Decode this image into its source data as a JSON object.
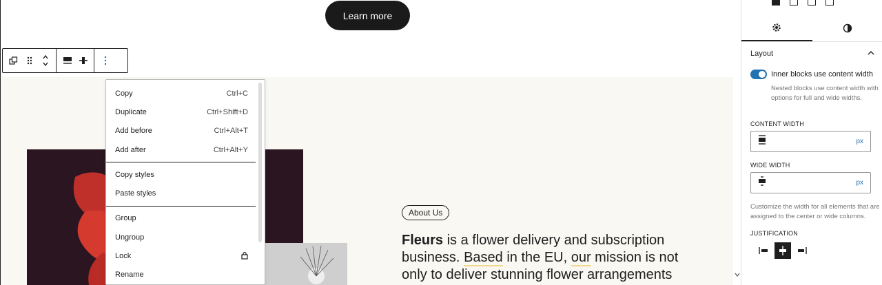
{
  "canvas": {
    "learn_more_label": "Learn more",
    "pill_label": "About Us",
    "paragraph_bold": "Fleurs",
    "paragraph_rest_1": " is a flower delivery and subscription business. ",
    "paragraph_hl_1": "Based",
    "paragraph_rest_2": " in the EU, ",
    "paragraph_hl_2": "our",
    "paragraph_rest_3": " mission is not only to deliver stunning flower arrangements"
  },
  "toolbar": {
    "icons": [
      "duplicate-icon",
      "drag-handle-icon",
      "move-up-down-icon",
      "align-wide-icon",
      "align-center-icon",
      "more-options-icon"
    ]
  },
  "context_menu": {
    "items": [
      {
        "label": "Copy",
        "shortcut": "Ctrl+C"
      },
      {
        "label": "Duplicate",
        "shortcut": "Ctrl+Shift+D"
      },
      {
        "label": "Add before",
        "shortcut": "Ctrl+Alt+T"
      },
      {
        "label": "Add after",
        "shortcut": "Ctrl+Alt+Y"
      },
      {
        "label": "Copy styles",
        "shortcut": ""
      },
      {
        "label": "Paste styles",
        "shortcut": ""
      },
      {
        "label": "Group",
        "shortcut": ""
      },
      {
        "label": "Ungroup",
        "shortcut": ""
      },
      {
        "label": "Lock",
        "shortcut": ""
      },
      {
        "label": "Rename",
        "shortcut": ""
      }
    ]
  },
  "sidebar": {
    "panel_title": "Layout",
    "toggle_label": "Inner blocks use content width",
    "toggle_on": true,
    "toggle_help": "Nested blocks use content width with options for full and wide widths.",
    "content_width_label": "CONTENT WIDTH",
    "content_width_value": "",
    "content_width_unit": "px",
    "wide_width_label": "WIDE WIDTH",
    "wide_width_value": "",
    "wide_width_unit": "px",
    "width_help": "Customize the width for all elements that are assigned to the center or wide columns.",
    "justification_label": "JUSTIFICATION",
    "accent_color": "#2271b1"
  }
}
